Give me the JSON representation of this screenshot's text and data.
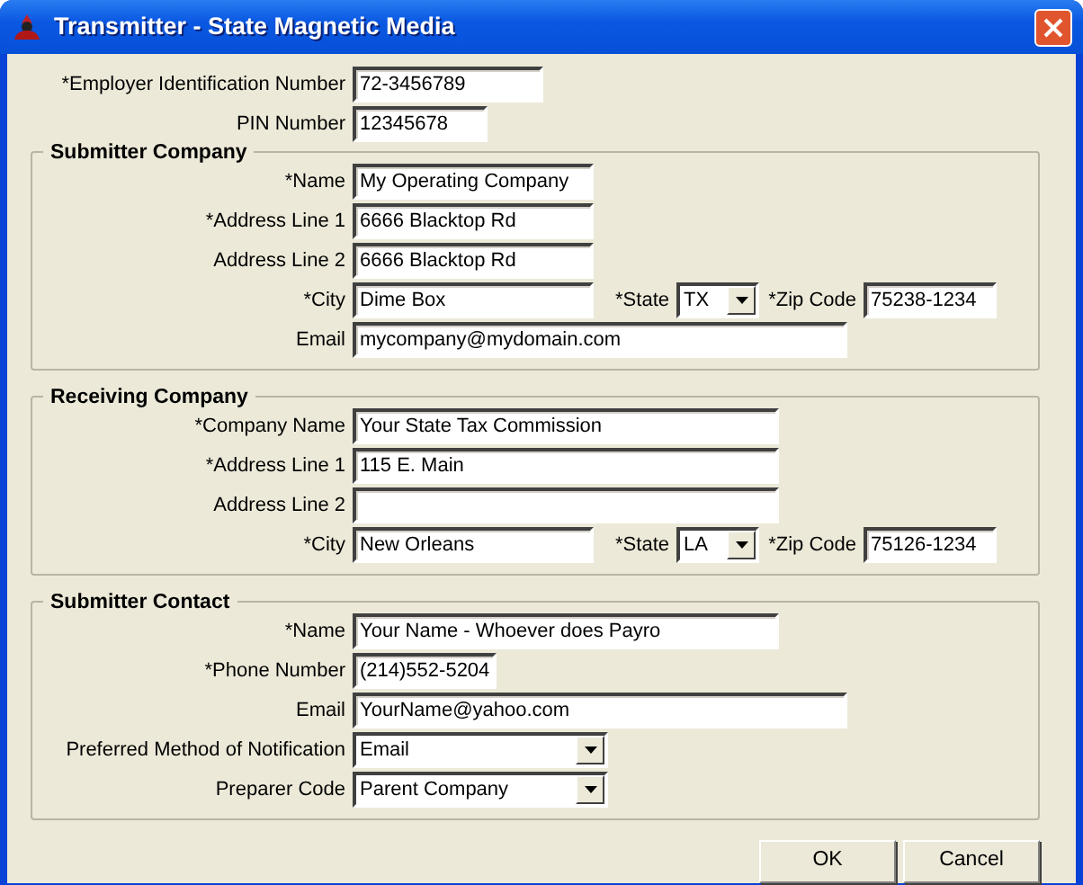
{
  "window": {
    "title": "Transmitter - State Magnetic Media"
  },
  "top_fields": [
    {
      "kind": "text",
      "label": "*Employer Identification Number",
      "value": "72-3456789"
    },
    {
      "kind": "text",
      "label": "PIN Number",
      "value": "12345678"
    }
  ],
  "sections": [
    {
      "title": "Submitter Company",
      "rows": [
        {
          "kind": "text",
          "label": "*Name",
          "value": "My Operating Company"
        },
        {
          "kind": "text",
          "label": "*Address Line 1",
          "value": "6666 Blacktop Rd"
        },
        {
          "kind": "text",
          "label": "Address Line 2",
          "value": "6666 Blacktop Rd"
        },
        {
          "kind": "city",
          "label": "*City",
          "value": "Dime Box",
          "state_label": "*State",
          "state": "TX",
          "zip_label": "*Zip Code",
          "zip": "75238-1234"
        },
        {
          "kind": "text",
          "label": "Email",
          "value": "mycompany@mydomain.com"
        }
      ]
    },
    {
      "title": "Receiving Company",
      "rows": [
        {
          "kind": "text",
          "label": "*Company Name",
          "value": "Your State Tax Commission"
        },
        {
          "kind": "text",
          "label": "*Address Line 1",
          "value": "115 E. Main"
        },
        {
          "kind": "text",
          "label": "Address Line 2"
        },
        {
          "kind": "city",
          "label": "*City",
          "value": "New Orleans",
          "state_label": "*State",
          "state": "LA",
          "zip_label": "*Zip Code",
          "zip": "75126-1234"
        }
      ]
    },
    {
      "title": "Submitter Contact",
      "rows": [
        {
          "kind": "text",
          "label": "*Name",
          "value": "Your Name - Whoever does Payro"
        },
        {
          "kind": "text",
          "label": "*Phone Number",
          "value": "(214)552-5204"
        },
        {
          "kind": "text",
          "label": "Email",
          "value": "YourName@yahoo.com"
        },
        {
          "kind": "select",
          "label": "Preferred Method of Notification",
          "value": "Email"
        },
        {
          "kind": "select",
          "label": "Preparer Code",
          "value": "Parent Company"
        }
      ]
    }
  ],
  "buttons": [
    "OK",
    "Cancel"
  ]
}
